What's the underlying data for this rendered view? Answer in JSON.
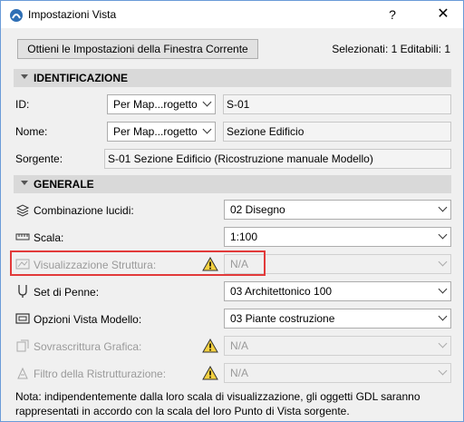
{
  "window": {
    "title": "Impostazioni Vista",
    "help": "?",
    "close": "✕"
  },
  "top": {
    "button_label": "Ottieni le Impostazioni della Finestra Corrente",
    "selection_info": "Selezionati: 1 Editabili: 1"
  },
  "identificazione": {
    "header": "IDENTIFICAZIONE",
    "id": {
      "label": "ID:",
      "mode": "Per Map...rogetto",
      "value": "S-01"
    },
    "nome": {
      "label": "Nome:",
      "mode": "Per Map...rogetto",
      "value": "Sezione Edificio"
    },
    "sorgente": {
      "label": "Sorgente:",
      "value": "S-01 Sezione Edificio (Ricostruzione manuale Modello)"
    }
  },
  "generale": {
    "header": "GENERALE",
    "combinazione": {
      "label": "Combinazione lucidi:",
      "value": "02 Disegno"
    },
    "scala": {
      "label": "Scala:",
      "value": "1:100"
    },
    "struttura": {
      "label": "Visualizzazione Struttura:",
      "value": "N/A"
    },
    "penne": {
      "label": "Set di Penne:",
      "value": "03 Architettonico 100"
    },
    "opzioni": {
      "label": "Opzioni Vista Modello:",
      "value": "03 Piante costruzione"
    },
    "sovrascrittura": {
      "label": "Sovrascrittura Grafica:",
      "value": "N/A"
    },
    "filtro": {
      "label": "Filtro della Ristrutturazione:",
      "value": "N/A"
    }
  },
  "note": "Nota: indipendentemente dalla loro scala di visualizzazione, gli oggetti GDL saranno rappresentati in accordo con la scala del loro Punto di Vista sorgente."
}
